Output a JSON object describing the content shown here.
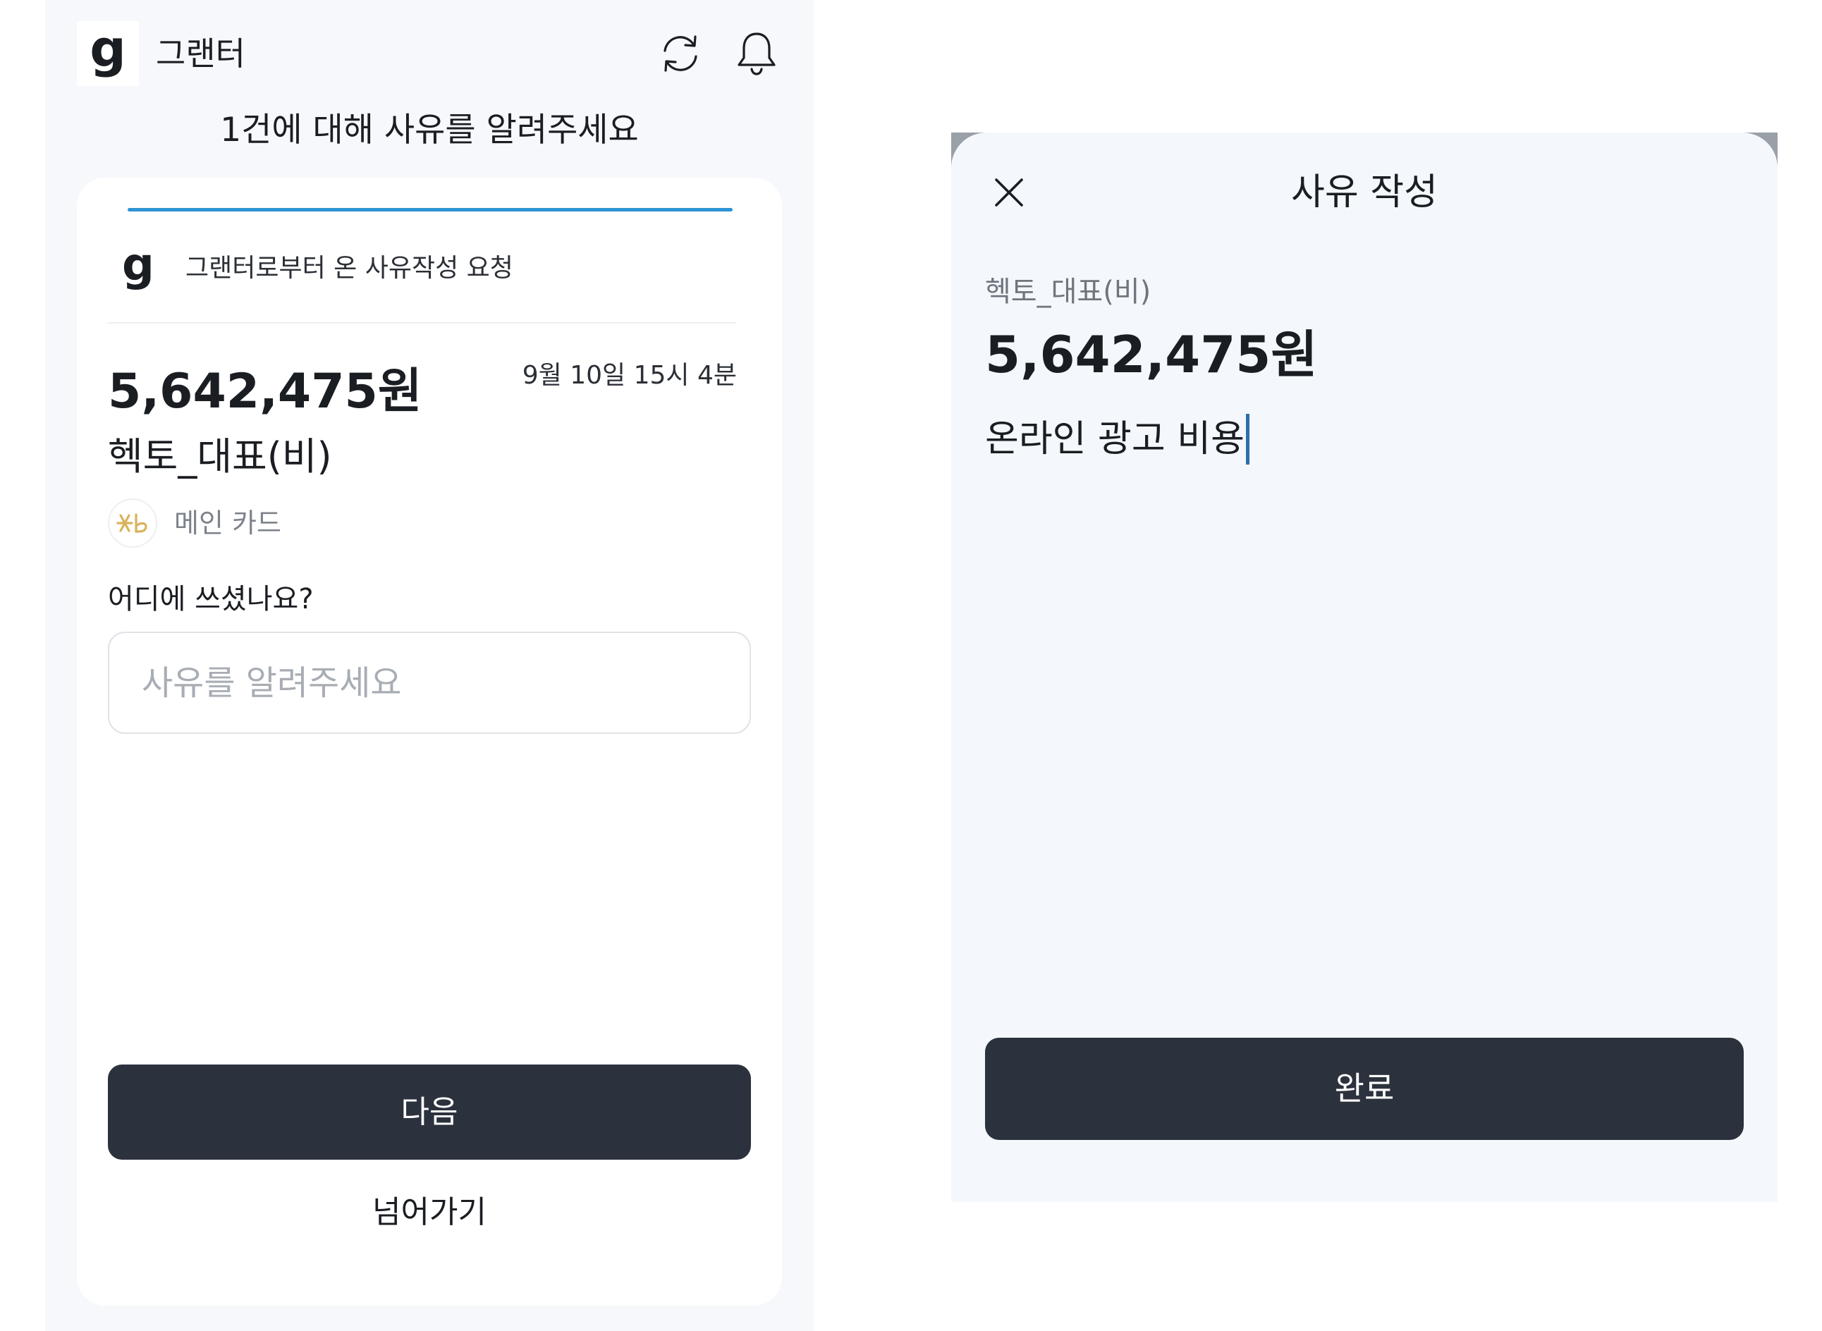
{
  "left": {
    "header": {
      "logo_glyph": "g",
      "app_name": "그랜터",
      "icons": [
        "refresh-icon",
        "bell-icon"
      ]
    },
    "heading": "1건에 대해 사유를 알려주세요",
    "progress": 1.0,
    "request": {
      "logo_glyph": "g",
      "text": "그랜터로부터 온 사유작성 요청"
    },
    "transaction": {
      "amount": "5,642,475원",
      "datetime": "9월 10일 15시 4분",
      "merchant": "헥토_대표(비)",
      "card_name": "메인 카드",
      "card_logo_color": "#d9b25a"
    },
    "question": "어디에 쓰셨나요?",
    "input": {
      "value": "",
      "placeholder": "사유를 알려주세요"
    },
    "next_label": "다음",
    "skip_label": "넘어가기"
  },
  "right": {
    "title": "사유 작성",
    "merchant": "헥토_대표(비)",
    "amount": "5,642,475원",
    "reason_text": "온라인 광고 비용",
    "done_label": "완료"
  },
  "colors": {
    "primary_button": "#2c323d",
    "progress": "#2f93d3",
    "screen_bg": "#f6f8fb",
    "sheet_bg": "#f4f8fc",
    "caret": "#2e6ea6"
  }
}
